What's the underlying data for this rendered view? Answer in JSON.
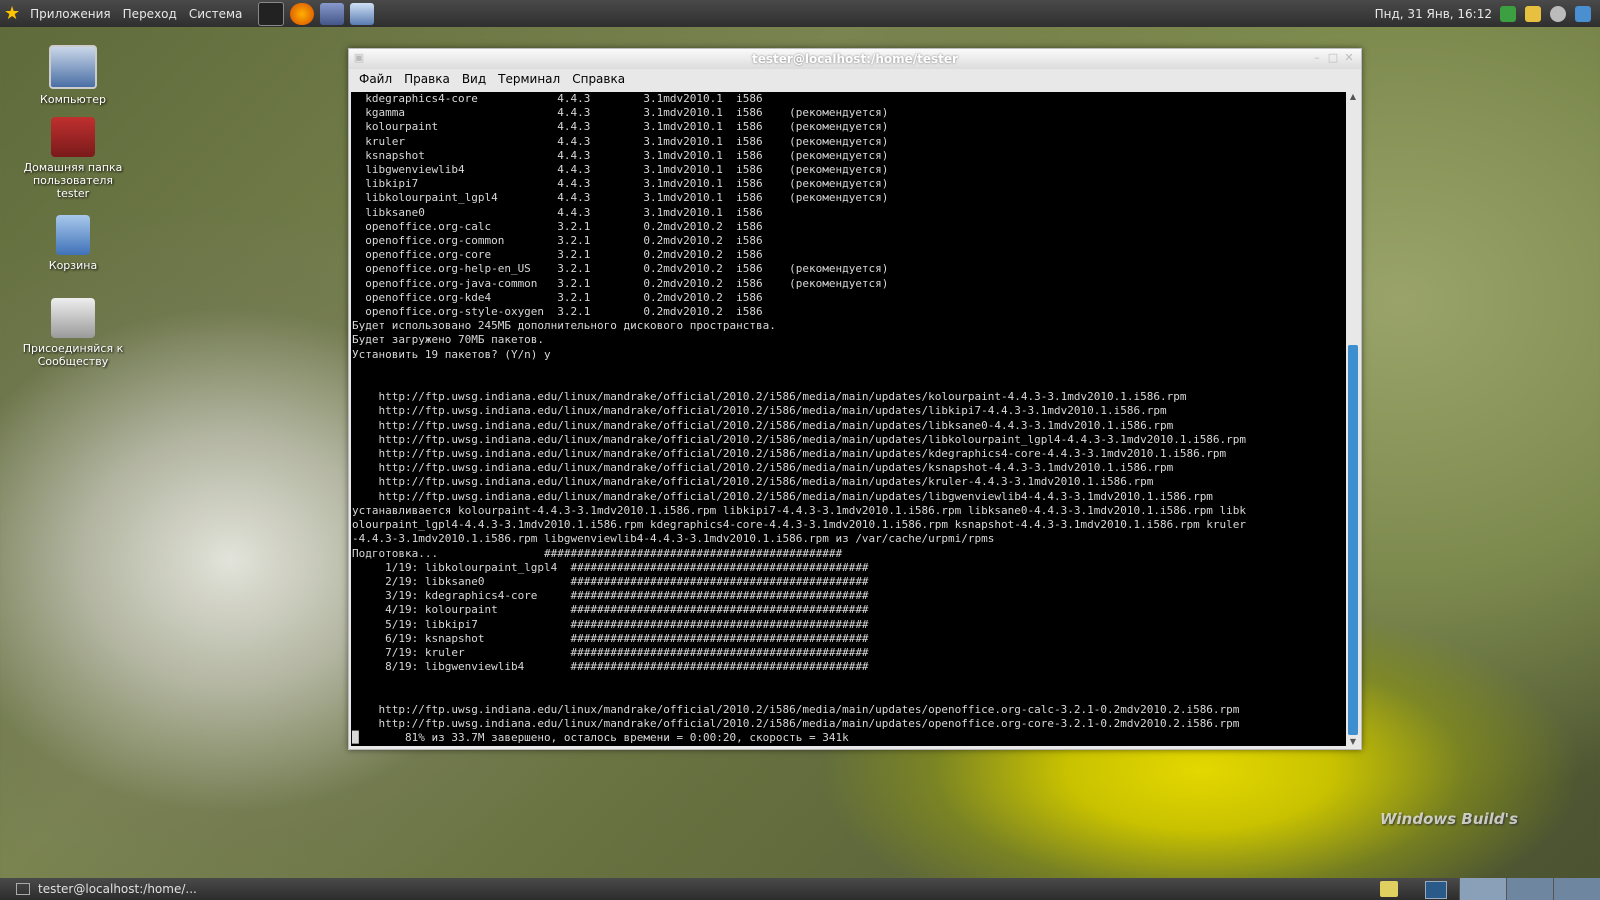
{
  "top_panel": {
    "menus": [
      "Приложения",
      "Переход",
      "Система"
    ],
    "clock": "Пнд, 31 Янв, 16:12"
  },
  "desktop_icons": [
    {
      "label": "Компьютер"
    },
    {
      "label": "Домашняя папка пользователя tester"
    },
    {
      "label": "Корзина"
    },
    {
      "label": "Присоединяйся к Сообществу"
    }
  ],
  "window": {
    "title": "tester@localhost:/home/tester",
    "menu": [
      "Файл",
      "Правка",
      "Вид",
      "Терминал",
      "Справка"
    ]
  },
  "terminal_text": "  kdegraphics4-core            4.4.3        3.1mdv2010.1  i586\n  kgamma                       4.4.3        3.1mdv2010.1  i586    (рекомендуется)\n  kolourpaint                  4.4.3        3.1mdv2010.1  i586    (рекомендуется)\n  kruler                       4.4.3        3.1mdv2010.1  i586    (рекомендуется)\n  ksnapshot                    4.4.3        3.1mdv2010.1  i586    (рекомендуется)\n  libgwenviewlib4              4.4.3        3.1mdv2010.1  i586    (рекомендуется)\n  libkipi7                     4.4.3        3.1mdv2010.1  i586    (рекомендуется)\n  libkolourpaint_lgpl4         4.4.3        3.1mdv2010.1  i586    (рекомендуется)\n  libksane0                    4.4.3        3.1mdv2010.1  i586\n  openoffice.org-calc          3.2.1        0.2mdv2010.2  i586\n  openoffice.org-common        3.2.1        0.2mdv2010.2  i586\n  openoffice.org-core          3.2.1        0.2mdv2010.2  i586\n  openoffice.org-help-en_US    3.2.1        0.2mdv2010.2  i586    (рекомендуется)\n  openoffice.org-java-common   3.2.1        0.2mdv2010.2  i586    (рекомендуется)\n  openoffice.org-kde4          3.2.1        0.2mdv2010.2  i586\n  openoffice.org-style-oxygen  3.2.1        0.2mdv2010.2  i586\nБудет использовано 245МБ дополнительного дискового пространства.\nБудет загружено 70МБ пакетов.\nУстановить 19 пакетов? (Y/n) y\n\n\n    http://ftp.uwsg.indiana.edu/linux/mandrake/official/2010.2/i586/media/main/updates/kolourpaint-4.4.3-3.1mdv2010.1.i586.rpm\n    http://ftp.uwsg.indiana.edu/linux/mandrake/official/2010.2/i586/media/main/updates/libkipi7-4.4.3-3.1mdv2010.1.i586.rpm\n    http://ftp.uwsg.indiana.edu/linux/mandrake/official/2010.2/i586/media/main/updates/libksane0-4.4.3-3.1mdv2010.1.i586.rpm\n    http://ftp.uwsg.indiana.edu/linux/mandrake/official/2010.2/i586/media/main/updates/libkolourpaint_lgpl4-4.4.3-3.1mdv2010.1.i586.rpm\n    http://ftp.uwsg.indiana.edu/linux/mandrake/official/2010.2/i586/media/main/updates/kdegraphics4-core-4.4.3-3.1mdv2010.1.i586.rpm\n    http://ftp.uwsg.indiana.edu/linux/mandrake/official/2010.2/i586/media/main/updates/ksnapshot-4.4.3-3.1mdv2010.1.i586.rpm\n    http://ftp.uwsg.indiana.edu/linux/mandrake/official/2010.2/i586/media/main/updates/kruler-4.4.3-3.1mdv2010.1.i586.rpm\n    http://ftp.uwsg.indiana.edu/linux/mandrake/official/2010.2/i586/media/main/updates/libgwenviewlib4-4.4.3-3.1mdv2010.1.i586.rpm\nустанавливается kolourpaint-4.4.3-3.1mdv2010.1.i586.rpm libkipi7-4.4.3-3.1mdv2010.1.i586.rpm libksane0-4.4.3-3.1mdv2010.1.i586.rpm libk\nolourpaint_lgpl4-4.4.3-3.1mdv2010.1.i586.rpm kdegraphics4-core-4.4.3-3.1mdv2010.1.i586.rpm ksnapshot-4.4.3-3.1mdv2010.1.i586.rpm kruler\n-4.4.3-3.1mdv2010.1.i586.rpm libgwenviewlib4-4.4.3-3.1mdv2010.1.i586.rpm из /var/cache/urpmi/rpms\nПодготовка...                #############################################\n     1/19: libkolourpaint_lgpl4  #############################################\n     2/19: libksane0             #############################################\n     3/19: kdegraphics4-core     #############################################\n     4/19: kolourpaint           #############################################\n     5/19: libkipi7              #############################################\n     6/19: ksnapshot             #############################################\n     7/19: kruler                #############################################\n     8/19: libgwenviewlib4       #############################################\n\n\n    http://ftp.uwsg.indiana.edu/linux/mandrake/official/2010.2/i586/media/main/updates/openoffice.org-calc-3.2.1-0.2mdv2010.2.i586.rpm\n    http://ftp.uwsg.indiana.edu/linux/mandrake/official/2010.2/i586/media/main/updates/openoffice.org-core-3.2.1-0.2mdv2010.2.i586.rpm\n█       81% из 33.7M завершено, осталось времени = 0:00:20, скорость = 341k",
  "taskbar": {
    "task_label": "tester@localhost:/home/..."
  },
  "watermark": "Windows Build's",
  "colors": {
    "panel": "#3a3a3a",
    "terminal_bg": "#000000",
    "terminal_fg": "#d8d8d8",
    "scroll_thumb": "#3d8fd0"
  }
}
